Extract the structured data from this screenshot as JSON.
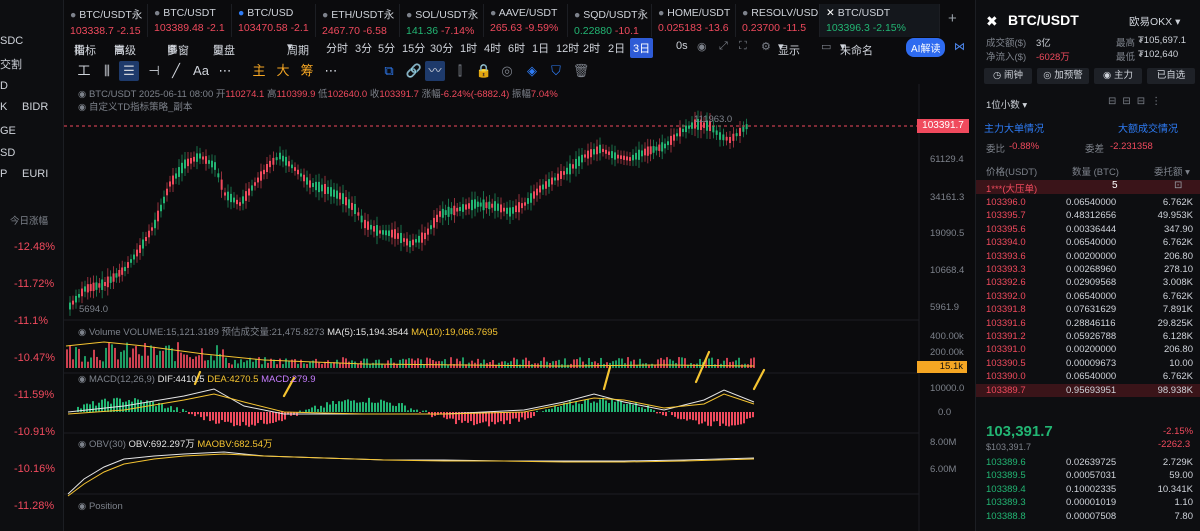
{
  "left": {
    "items": [
      "SDC",
      "交割",
      "D",
      "K",
      "GE",
      "SD",
      "P"
    ],
    "items_right": [
      "BIDR",
      "EURI"
    ],
    "change_header": "今日涨幅",
    "changes": [
      "-12.48%",
      "-11.72%",
      "-11.1%",
      "-10.47%",
      "-11.59%",
      "-10.91%",
      "-10.16%",
      "-11.28%"
    ]
  },
  "tabs": [
    {
      "name": "BTC/USDT永",
      "price": "103338.7",
      "change": "-2.15"
    },
    {
      "name": "BTC/USDT",
      "price": "103389.48",
      "change": "-2.1"
    },
    {
      "name": "BTC/USD",
      "price": "103470.58",
      "change": "-2.1"
    },
    {
      "name": "ETH/USDT永",
      "price": "2467.70",
      "change": "-6.58"
    },
    {
      "name": "SOL/USDT永",
      "price": "141.36",
      "change": "-7.14%"
    },
    {
      "name": "AAVE/USDT",
      "price": "265.63",
      "change": "-9.59%"
    },
    {
      "name": "SQD/USDT永",
      "price": "0.22880",
      "change": "-10.1"
    },
    {
      "name": "HOME/USDT",
      "price": "0.025183",
      "change": "-13.6"
    },
    {
      "name": "RESOLV/USD",
      "price": "0.23700",
      "change": "-11.5"
    },
    {
      "name": "BTC/USDT",
      "price": "103396.3",
      "change": "-2.15%"
    }
  ],
  "toolbar": {
    "indicator": "指标",
    "advanced": "高级",
    "multi": "多窗",
    "review": "复盘",
    "period": "周期",
    "intervals": [
      "分时",
      "3分",
      "5分",
      "15分",
      "30分",
      "1时",
      "4时",
      "6时",
      "1日",
      "12时",
      "2时",
      "2日",
      "3日"
    ],
    "active_interval": "3日",
    "seconds": "0s",
    "display": "显示",
    "unnamed": "未命名",
    "ai": "AI解读"
  },
  "drawing_tools": [
    "主",
    "大",
    "筹"
  ],
  "info": {
    "symbol": "BTC/USDT",
    "date": "2025-06-11 08:00",
    "open_label": "开",
    "open": "110274.1",
    "high_label": "高",
    "high": "110399.9",
    "low_label": "低",
    "low": "102640.0",
    "close_label": "收",
    "close": "103391.7",
    "change_label": "涨幅",
    "change": "-6.24%(-6882.4)",
    "amp_label": "振幅",
    "amp": "7.04%",
    "strategy": "自定义TD指标策略_副本"
  },
  "chart_data": {
    "type": "candlestick",
    "price_labels": [
      "61129.4",
      "34161.3",
      "19090.5",
      "10668.4",
      "5961.9"
    ],
    "current_price": "103391.7",
    "high_mark": "111963.0",
    "low_mark": "5694.0",
    "volume": {
      "title": "Volume",
      "vol": "VOLUME:15,121.3189",
      "forecast": "预估成交量:21,475.8273",
      "ma5": "MA(5):15,194.3544",
      "ma10": "MA(10):19,066.7695",
      "axis": [
        "400.00k",
        "200.00k"
      ],
      "current": "15.1k"
    },
    "macd": {
      "title": "MACD(12,26,9)",
      "dif": "DIF:4410.5",
      "dea": "DEA:4270.5",
      "macd": "MACD:279.9",
      "axis": [
        "10000.0",
        "0.0"
      ]
    },
    "obv": {
      "title": "OBV(30)",
      "obv": "OBV:692.297万",
      "maobv": "MAOBV:682.54万",
      "axis": [
        "8.00M",
        "6.00M"
      ]
    },
    "position": "Position"
  },
  "right": {
    "symbol": "BTC/USDT",
    "exchange": "欧易OKX",
    "vol_label": "成交额($)",
    "vol": "3亿",
    "inflow_label": "净流入($)",
    "inflow": "-6028万",
    "high_label": "最高",
    "high": "₮105,697.1",
    "low_label": "最低",
    "low": "₮102,640",
    "buttons": [
      "闹钟",
      "加预警",
      "主力",
      "已自选"
    ],
    "precision": "1位小数",
    "main_big": "主力大单情况",
    "big_trades": "大额成交情况",
    "ratio_label": "委比",
    "ratio": "-0.88%",
    "diff_label": "委差",
    "diff": "-2.231358",
    "headers": [
      "价格(USDT)",
      "数量 (BTC)",
      "委托额"
    ],
    "big_order": "1***(大压单)",
    "big_order_count": "5",
    "asks": [
      [
        "103396.0",
        "0.06540000",
        "6.762K"
      ],
      [
        "103395.7",
        "0.48312656",
        "49.953K"
      ],
      [
        "103395.6",
        "0.00336444",
        "347.90"
      ],
      [
        "103394.0",
        "0.06540000",
        "6.762K"
      ],
      [
        "103393.6",
        "0.00200000",
        "206.80"
      ],
      [
        "103393.3",
        "0.00268960",
        "278.10"
      ],
      [
        "103392.6",
        "0.02909568",
        "3.008K"
      ],
      [
        "103392.0",
        "0.06540000",
        "6.762K"
      ],
      [
        "103391.8",
        "0.07631629",
        "7.891K"
      ],
      [
        "103391.6",
        "0.28846116",
        "29.825K"
      ],
      [
        "103391.2",
        "0.05926788",
        "6.128K"
      ],
      [
        "103391.0",
        "0.00200000",
        "206.80"
      ],
      [
        "103390.5",
        "0.00009673",
        "10.00"
      ],
      [
        "103390.0",
        "0.06540000",
        "6.762K"
      ],
      [
        "103389.7",
        "0.95693951",
        "98.938K"
      ]
    ],
    "last_price": "103,391.7",
    "last_sub": "$103,391.7",
    "last_change": "-2.15%",
    "last_diff": "-2262.3",
    "bids": [
      [
        "103389.6",
        "0.02639725",
        "2.729K"
      ],
      [
        "103389.5",
        "0.00057031",
        "59.00"
      ],
      [
        "103389.4",
        "0.10002335",
        "10.341K"
      ],
      [
        "103389.3",
        "0.00001019",
        "1.10"
      ],
      [
        "103388.8",
        "0.00007508",
        "7.80"
      ]
    ]
  }
}
